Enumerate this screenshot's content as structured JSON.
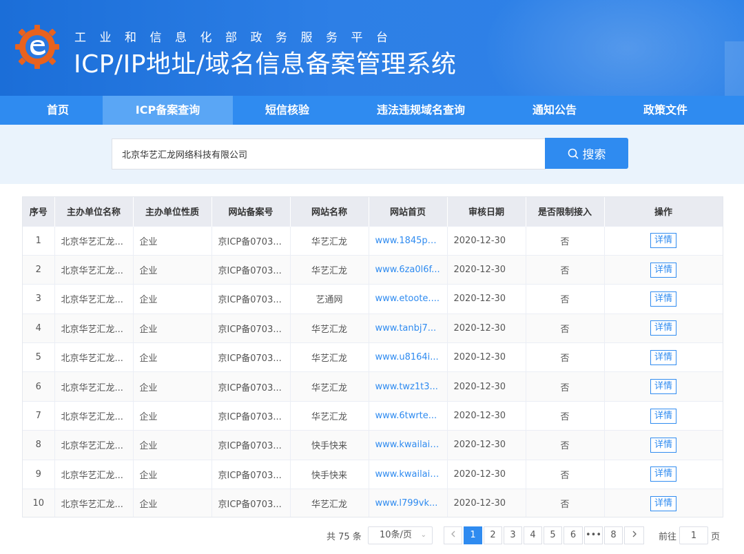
{
  "header": {
    "subtitle": "工业和信息化部政务服务平台",
    "title": "ICP/IP地址/域名信息备案管理系统"
  },
  "nav": {
    "items": [
      {
        "label": "首页"
      },
      {
        "label": "ICP备案查询",
        "active": true
      },
      {
        "label": "短信核验"
      },
      {
        "label": "违法违规域名查询"
      },
      {
        "label": "通知公告"
      },
      {
        "label": "政策文件"
      }
    ]
  },
  "search": {
    "value": "北京华艺汇龙网络科技有限公司",
    "button_label": "搜索",
    "button_icon": "search-icon"
  },
  "table": {
    "columns": [
      "序号",
      "主办单位名称",
      "主办单位性质",
      "网站备案号",
      "网站名称",
      "网站首页",
      "审核日期",
      "是否限制接入",
      "操作"
    ],
    "rows": [
      {
        "no": "1",
        "org": "北京华艺汇龙...",
        "type": "企业",
        "record": "京ICP备0703...",
        "site": "华艺汇龙",
        "home": "www.1845p3...",
        "date": "2020-12-30",
        "limited": "否",
        "action": "详情"
      },
      {
        "no": "2",
        "org": "北京华艺汇龙...",
        "type": "企业",
        "record": "京ICP备0703...",
        "site": "华艺汇龙",
        "home": "www.6za0l6f...",
        "date": "2020-12-30",
        "limited": "否",
        "action": "详情"
      },
      {
        "no": "3",
        "org": "北京华艺汇龙...",
        "type": "企业",
        "record": "京ICP备0703...",
        "site": "艺通网",
        "home": "www.etoote....",
        "date": "2020-12-30",
        "limited": "否",
        "action": "详情"
      },
      {
        "no": "4",
        "org": "北京华艺汇龙...",
        "type": "企业",
        "record": "京ICP备0703...",
        "site": "华艺汇龙",
        "home": "www.tanbj7...",
        "date": "2020-12-30",
        "limited": "否",
        "action": "详情"
      },
      {
        "no": "5",
        "org": "北京华艺汇龙...",
        "type": "企业",
        "record": "京ICP备0703...",
        "site": "华艺汇龙",
        "home": "www.u8164i...",
        "date": "2020-12-30",
        "limited": "否",
        "action": "详情"
      },
      {
        "no": "6",
        "org": "北京华艺汇龙...",
        "type": "企业",
        "record": "京ICP备0703...",
        "site": "华艺汇龙",
        "home": "www.twz1t3...",
        "date": "2020-12-30",
        "limited": "否",
        "action": "详情"
      },
      {
        "no": "7",
        "org": "北京华艺汇龙...",
        "type": "企业",
        "record": "京ICP备0703...",
        "site": "华艺汇龙",
        "home": "www.6twrte...",
        "date": "2020-12-30",
        "limited": "否",
        "action": "详情"
      },
      {
        "no": "8",
        "org": "北京华艺汇龙...",
        "type": "企业",
        "record": "京ICP备0703...",
        "site": "快手快来",
        "home": "www.kwailai....",
        "date": "2020-12-30",
        "limited": "否",
        "action": "详情"
      },
      {
        "no": "9",
        "org": "北京华艺汇龙...",
        "type": "企业",
        "record": "京ICP备0703...",
        "site": "快手快来",
        "home": "www.kwailai....",
        "date": "2020-12-30",
        "limited": "否",
        "action": "详情"
      },
      {
        "no": "10",
        "org": "北京华艺汇龙...",
        "type": "企业",
        "record": "京ICP备0703...",
        "site": "华艺汇龙",
        "home": "www.l799vk...",
        "date": "2020-12-30",
        "limited": "否",
        "action": "详情"
      }
    ]
  },
  "pagination": {
    "total": "共 75 条",
    "page_size": "10条/页",
    "pages": [
      "1",
      "2",
      "3",
      "4",
      "5",
      "6",
      "•••",
      "8"
    ],
    "current": "1",
    "goto_label": "前往",
    "goto_value": "1",
    "page_suffix": "页"
  },
  "colors": {
    "primary": "#2f8bf0",
    "header_bg": "#1b6ed8",
    "logo_orange": "#e8621e"
  }
}
